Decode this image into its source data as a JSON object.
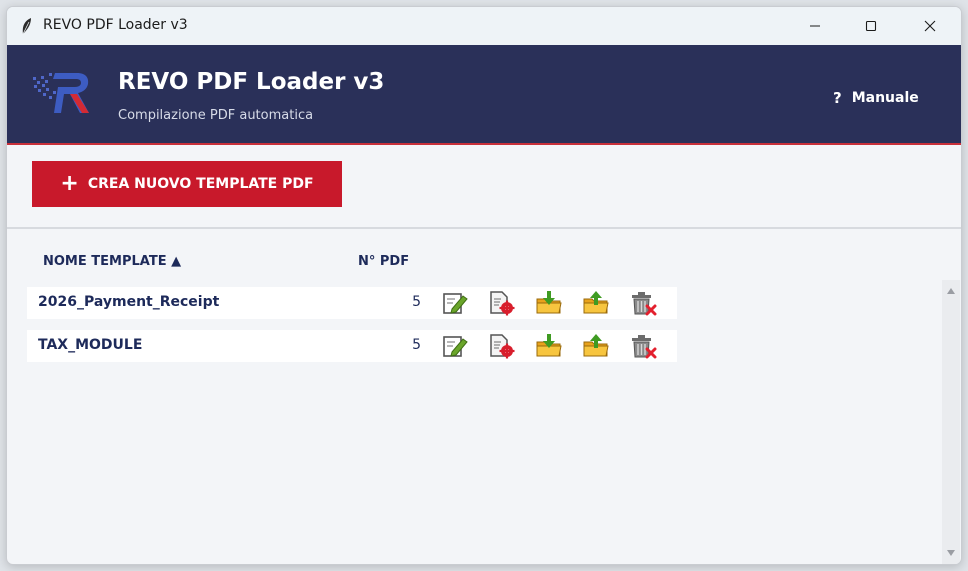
{
  "window": {
    "title": "REVO PDF Loader v3"
  },
  "header": {
    "title": "REVO PDF Loader v3",
    "subtitle": "Compilazione PDF automatica",
    "manual_label": "Manuale",
    "manual_icon": "?"
  },
  "actions": {
    "create_label": "CREA NUOVO TEMPLATE PDF",
    "create_icon": "+"
  },
  "table": {
    "columns": {
      "name": "NOME TEMPLATE ▲",
      "count": "N° PDF"
    },
    "rows": [
      {
        "name": "2026_Payment_Receipt",
        "count": "5"
      },
      {
        "name": "TAX_MODULE",
        "count": "5"
      }
    ],
    "row_actions": [
      "edit-icon",
      "pdf-settings-icon",
      "import-folder-icon",
      "export-folder-icon",
      "delete-icon"
    ]
  },
  "colors": {
    "header_bg": "#2a3059",
    "accent_red": "#c8192b",
    "text_navy": "#1d2a5a"
  }
}
